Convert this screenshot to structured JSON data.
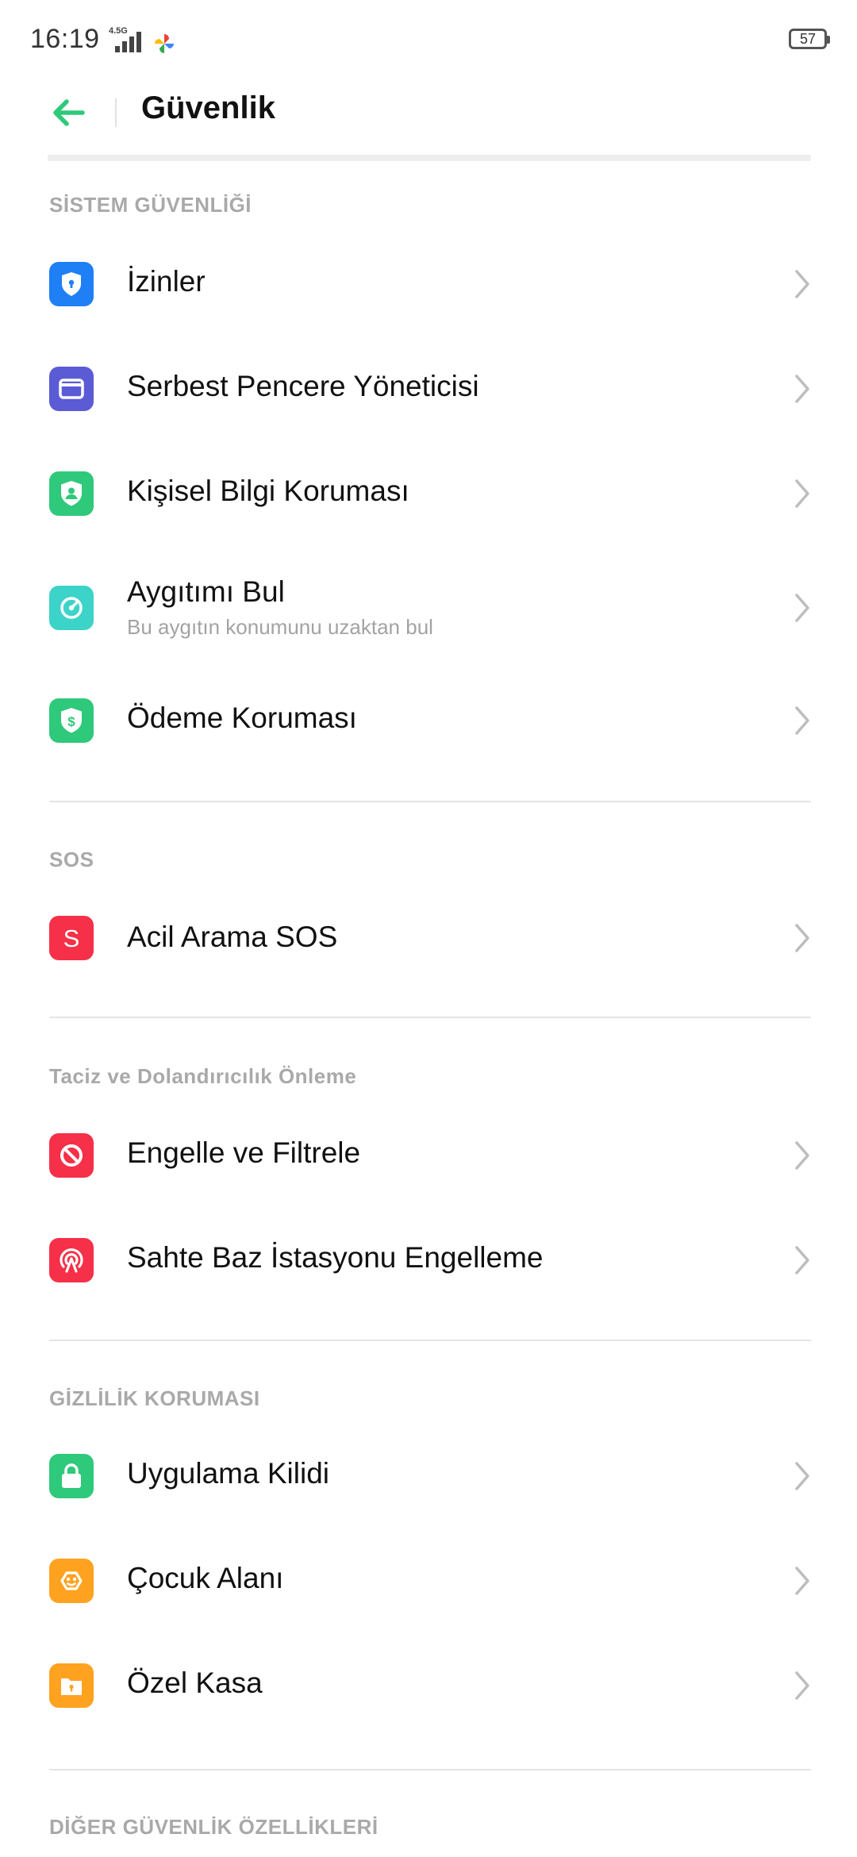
{
  "status_bar": {
    "time": "16:19",
    "network_type": "4.5G",
    "battery_level": "57"
  },
  "header": {
    "title": "Güvenlik"
  },
  "sections": [
    {
      "title": "SİSTEM GÜVENLİĞİ",
      "items": [
        {
          "label": "İzinler",
          "icon": "permissions-shield-icon",
          "color": "#1f7ff5"
        },
        {
          "label": "Serbest Pencere Yöneticisi",
          "icon": "floating-window-icon",
          "color": "#5b5bd6"
        },
        {
          "label": "Kişisel Bilgi Koruması",
          "icon": "personal-info-shield-icon",
          "color": "#2ec97a"
        },
        {
          "label": "Aygıtımı Bul",
          "sublabel": "Bu aygıtın konumunu uzaktan bul",
          "icon": "find-device-icon",
          "color": "#3cd3c9"
        },
        {
          "label": "Ödeme Koruması",
          "icon": "payment-shield-icon",
          "color": "#2ec97a"
        }
      ]
    },
    {
      "title": "SOS",
      "items": [
        {
          "label": "Acil Arama SOS",
          "icon": "sos-icon",
          "color": "#f53048"
        }
      ]
    },
    {
      "title": "Taciz ve Dolandırıcılık Önleme",
      "items": [
        {
          "label": "Engelle ve Filtrele",
          "icon": "block-filter-icon",
          "color": "#f53048"
        },
        {
          "label": "Sahte Baz İstasyonu Engelleme",
          "icon": "fake-station-icon",
          "color": "#f53048"
        }
      ]
    },
    {
      "title": "GİZLİLİK KORUMASI",
      "items": [
        {
          "label": "Uygulama Kilidi",
          "icon": "app-lock-icon",
          "color": "#2ec97a"
        },
        {
          "label": "Çocuk Alanı",
          "icon": "kids-space-icon",
          "color": "#ffa21f"
        },
        {
          "label": "Özel Kasa",
          "icon": "private-safe-icon",
          "color": "#ffa21f"
        }
      ]
    },
    {
      "title": "DİĞER GÜVENLİK ÖZELLİKLERİ",
      "items": []
    }
  ],
  "accent_color": "#2ec97a"
}
